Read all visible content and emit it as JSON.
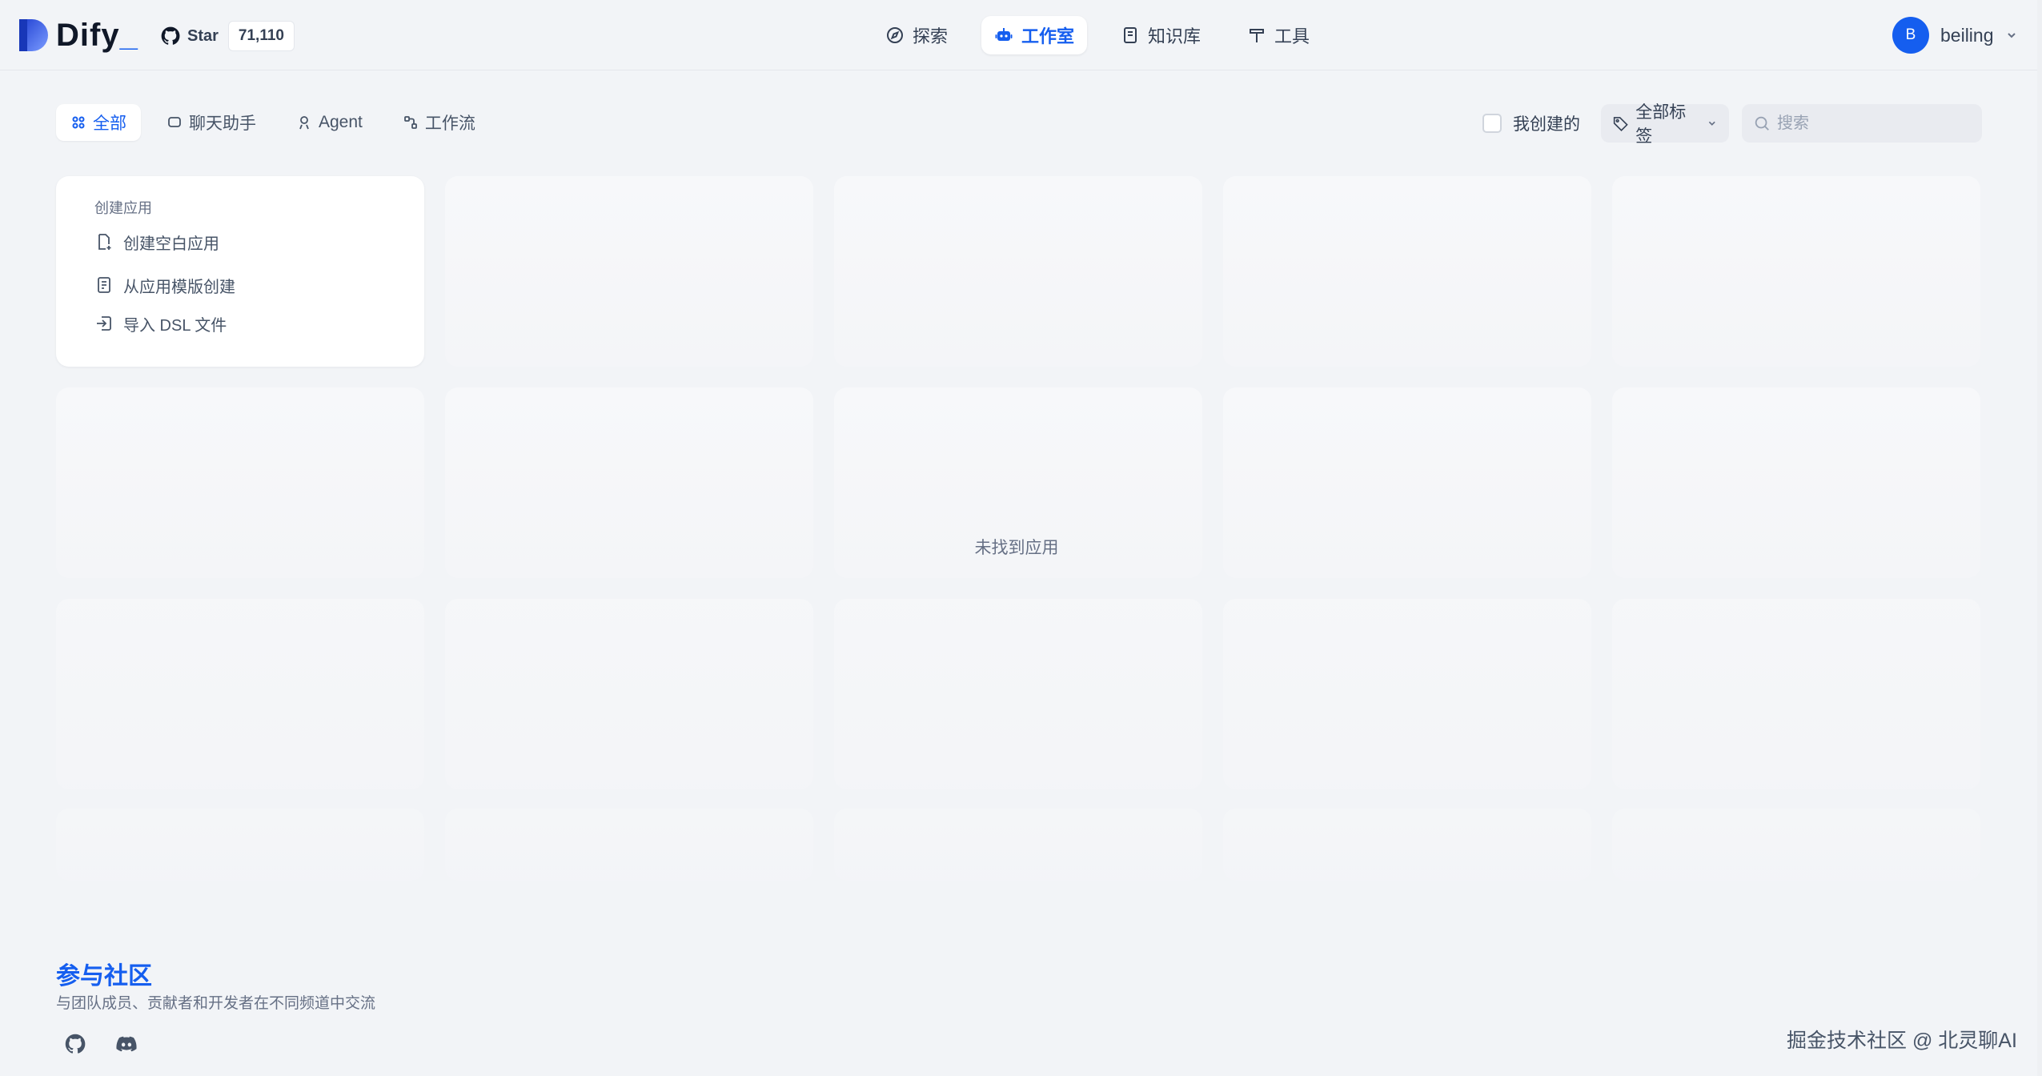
{
  "header": {
    "logo_text": "Dify",
    "logo_dot": "_",
    "star_label": "Star",
    "star_count": "71,110",
    "nav": [
      {
        "label": "探索",
        "icon": "compass-icon",
        "active": false
      },
      {
        "label": "工作室",
        "icon": "robot-icon",
        "active": true
      },
      {
        "label": "知识库",
        "icon": "book-icon",
        "active": false
      },
      {
        "label": "工具",
        "icon": "hammer-icon",
        "active": false
      }
    ],
    "user": {
      "avatar_letter": "B",
      "name": "beiling"
    }
  },
  "filters": {
    "tabs": [
      {
        "label": "全部",
        "icon": "grid-icon",
        "active": true
      },
      {
        "label": "聊天助手",
        "icon": "chat-icon",
        "active": false
      },
      {
        "label": "Agent",
        "icon": "agent-icon",
        "active": false
      },
      {
        "label": "工作流",
        "icon": "workflow-icon",
        "active": false
      }
    ],
    "mine_label": "我创建的",
    "mine_checked": false,
    "tags_label": "全部标签",
    "search_placeholder": "搜索",
    "search_value": ""
  },
  "create_card": {
    "title": "创建应用",
    "items": [
      {
        "label": "创建空白应用",
        "icon": "file-plus-icon"
      },
      {
        "label": "从应用模版创建",
        "icon": "template-icon"
      },
      {
        "label": "导入 DSL 文件",
        "icon": "import-icon"
      }
    ]
  },
  "empty_text": "未找到应用",
  "footer": {
    "title": "参与社区",
    "subtitle": "与团队成员、贡献者和开发者在不同频道中交流",
    "social": [
      "github-icon",
      "discord-icon"
    ]
  },
  "watermark": "掘金技术社区 @ 北灵聊AI"
}
